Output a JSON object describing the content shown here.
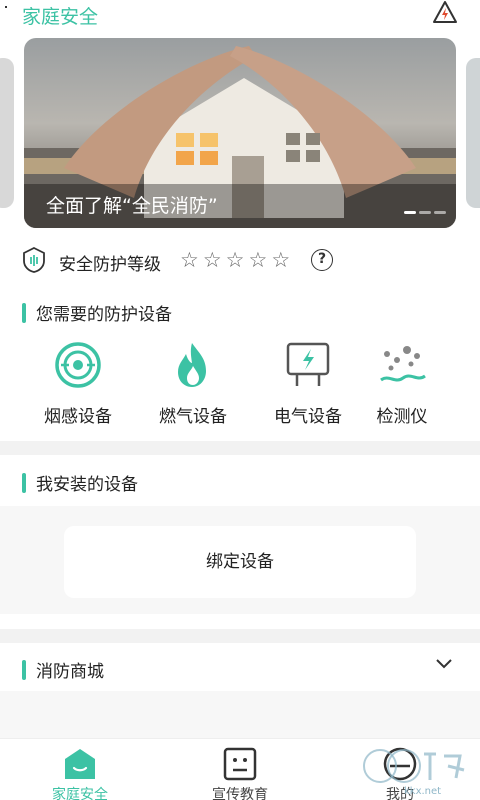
{
  "header": {
    "title": "家庭安全",
    "warning_icon": "high-voltage-warning-icon",
    "accent_color": "#3cc2a4"
  },
  "banner": {
    "caption": "全面了解“全民消防”",
    "dots_count": 3,
    "active_index": 0
  },
  "protection": {
    "label": "安全防护等级",
    "rating": 0,
    "max_rating": 5,
    "help_symbol": "?"
  },
  "sections": {
    "devices_title": "您需要的防护设备",
    "installed_title": "我安装的设备",
    "shop_title": "消防商城"
  },
  "devices": [
    {
      "name": "烟感设备",
      "icon": "smoke-detector-icon"
    },
    {
      "name": "燃气设备",
      "icon": "gas-flame-icon"
    },
    {
      "name": "电气设备",
      "icon": "electrical-panel-icon"
    },
    {
      "name": "检测仪",
      "icon": "particle-detector-icon"
    }
  ],
  "installed": {
    "bind_label": "绑定设备"
  },
  "nav": [
    {
      "label": "家庭安全",
      "icon": "home-icon",
      "active": true
    },
    {
      "label": "宣传教育",
      "icon": "education-icon",
      "active": false
    },
    {
      "label": "我的",
      "icon": "profile-icon",
      "active": false
    }
  ],
  "watermark": {
    "text": "kkx.net"
  }
}
